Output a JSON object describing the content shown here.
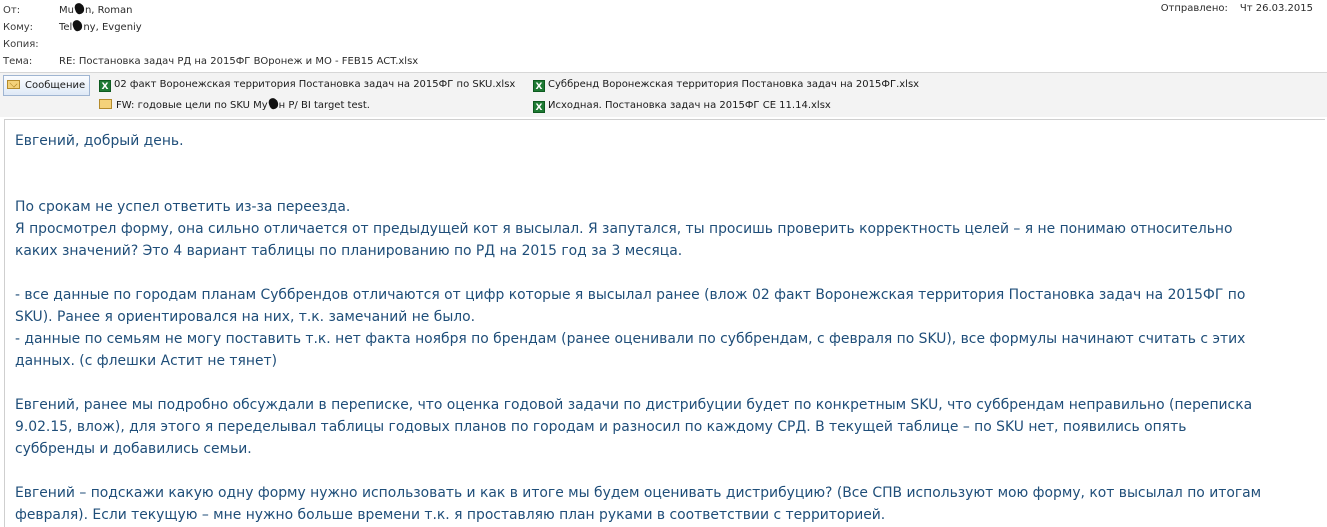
{
  "header": {
    "from_label": "От:",
    "from_a": "Mu",
    "from_b": "n, Roman",
    "to_label": "Кому:",
    "to_a": "Tel",
    "to_b": "ny, Evgeniy",
    "cc_label": "Копия:",
    "cc_value": "",
    "subject_label": "Тема:",
    "subject_value": "RE: Постановка задач РД на 2015ФГ ВОронеж и МО - FEB15 ACT.xlsx",
    "sent_label": "Отправлено:",
    "sent_value": "Чт 26.03.2015"
  },
  "attachments": {
    "message_tab": "Сообщение",
    "items": [
      {
        "icon": "excel-icon",
        "name": "02 факт Воронежская территория   Постановка задач на 2015ФГ по SKU.xlsx"
      },
      {
        "icon": "excel-icon",
        "name": "Суббренд Воронежская территория  Постановка задач на 2015ФГ.xlsx"
      },
      {
        "icon": "mail-icon",
        "name_a": "FW: годовые цели по SKU Му",
        "name_b": "н Р/ BI target test."
      },
      {
        "icon": "excel-icon",
        "name": "Исходная.  Постановка задач на 2015ФГ СЕ 11.14.xlsx"
      }
    ]
  },
  "body": {
    "lines": [
      "Евгений, добрый день.",
      "",
      "",
      "По срокам не успел ответить из-за переезда.",
      "Я просмотрел  форму, она сильно отличается от предыдущей кот я высылал. Я запутался, ты просишь проверить корректность целей   – я не понимаю относительно",
      "каких значений? Это 4 вариант таблицы по планированию по РД на 2015 год  за 3 месяца.",
      "",
      "-   все данные по городам планам Суббрендов отличаются от цифр которые я высылал ранее (влож 02 факт Воронежская территория   Постановка задач на 2015ФГ по",
      "SKU).  Ранее я ориентировался на них, т.к. замечаний не было.",
      "-  данные по семьям не могу поставить т.к. нет факта ноября по брендам (ранее оценивали по суббрендам, с февраля по SKU), все формулы начинают считать с этих",
      "данных. (с флешки Астит не тянет)",
      "",
      "Евгений, ранее мы подробно обсуждали в переписке, что оценка годовой задачи по дистрибуции будет по конкретным SKU, что суббрендам неправильно (переписка",
      "9.02.15, влож), для этого я переделывал таблицы годовых планов по городам и разносил по каждому СРД.   В текущей таблице – по SKU нет, появились опять",
      "суббренды и добавились семьи.",
      "",
      "Евгений – подскажи какую одну форму нужно использовать и как в итоге мы будем оценивать дистрибуцию? (Все СПВ  используют мою форму, кот высылал по итогам",
      "февраля).  Если текущую – мне нужно больше времени т.к. я проставляю план руками в соответствии с территорией."
    ]
  }
}
